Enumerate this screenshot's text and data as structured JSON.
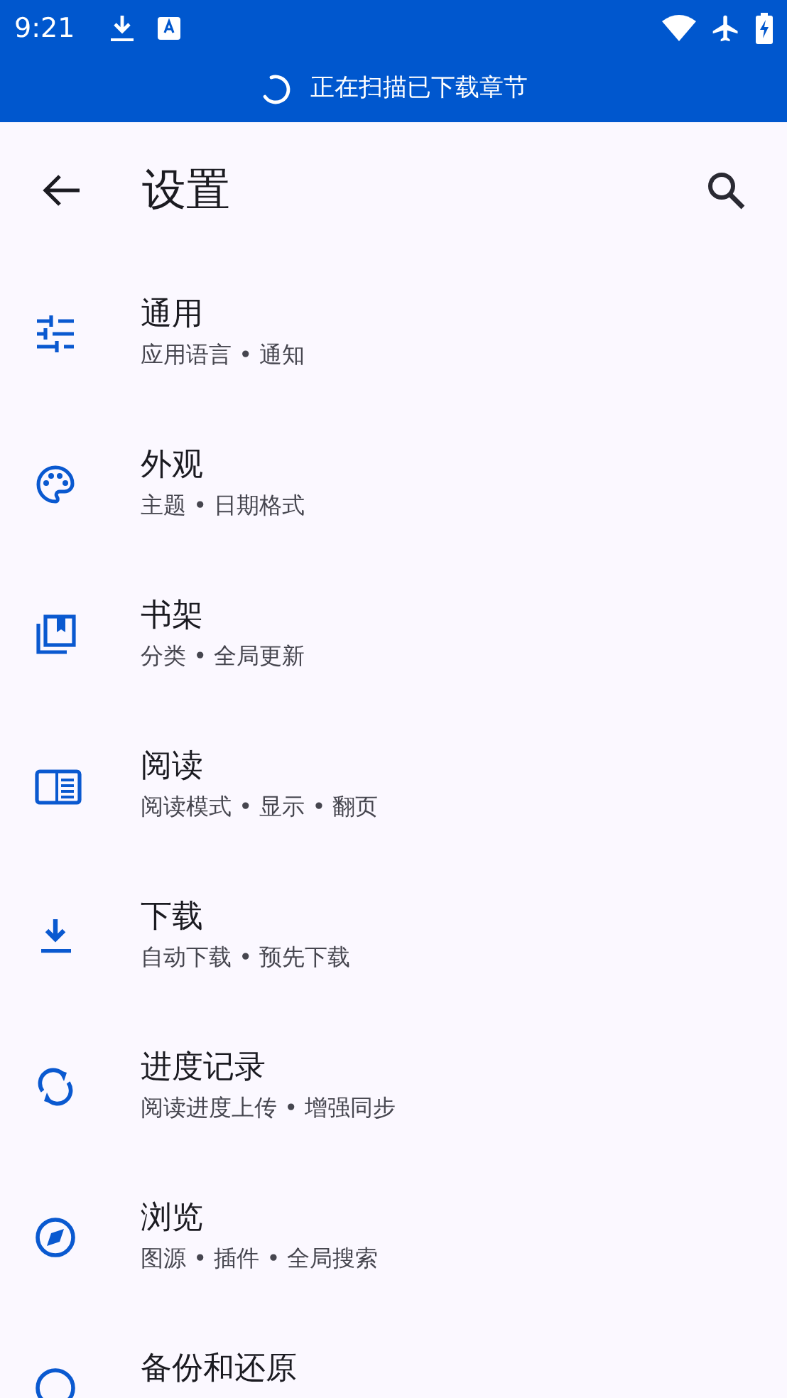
{
  "status_bar": {
    "time": "9:21"
  },
  "banner": {
    "text": "正在扫描已下载章节"
  },
  "app_bar": {
    "title": "设置"
  },
  "items": [
    {
      "title": "通用",
      "subtitle": "应用语言 • 通知"
    },
    {
      "title": "外观",
      "subtitle": "主题 • 日期格式"
    },
    {
      "title": "书架",
      "subtitle": "分类 • 全局更新"
    },
    {
      "title": "阅读",
      "subtitle": "阅读模式 • 显示 • 翻页"
    },
    {
      "title": "下载",
      "subtitle": "自动下载 • 预先下载"
    },
    {
      "title": "进度记录",
      "subtitle": "阅读进度上传 • 增强同步"
    },
    {
      "title": "浏览",
      "subtitle": "图源 • 插件 • 全局搜索"
    },
    {
      "title": "备份和还原"
    }
  ]
}
